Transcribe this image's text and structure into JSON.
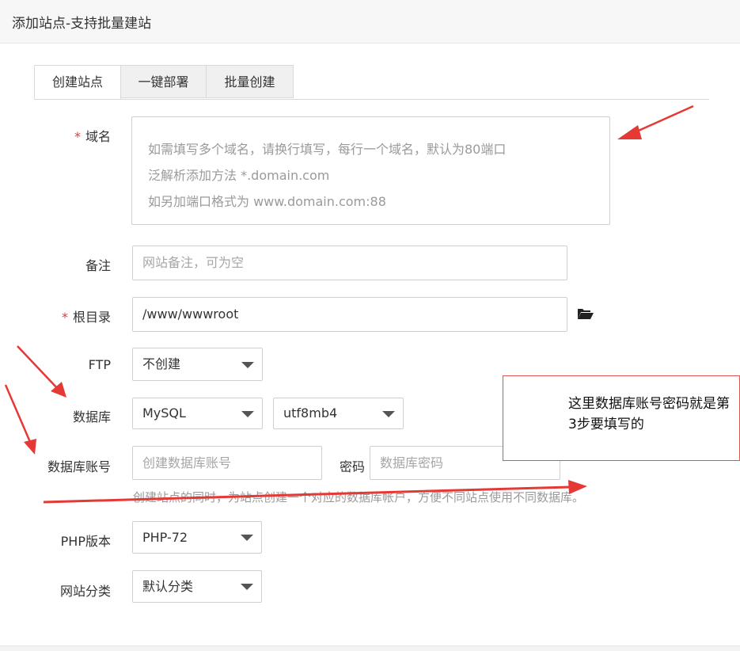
{
  "window": {
    "title": "添加站点-支持批量建站"
  },
  "tabs": [
    {
      "label": "创建站点",
      "active": true
    },
    {
      "label": "一键部署",
      "active": false
    },
    {
      "label": "批量创建",
      "active": false
    }
  ],
  "form": {
    "domain": {
      "required_mark": "*",
      "label": "域名",
      "placeholder_lines": [
        "如需填写多个域名，请换行填写，每行一个域名，默认为80端口",
        "泛解析添加方法 *.domain.com",
        "如另加端口格式为 www.domain.com:88"
      ]
    },
    "remark": {
      "label": "备注",
      "placeholder": "网站备注，可为空"
    },
    "root": {
      "required_mark": "*",
      "label": "根目录",
      "value": "/www/wwwroot",
      "icon": "folder-open-icon"
    },
    "ftp": {
      "label": "FTP",
      "selected": "不创建"
    },
    "database": {
      "label": "数据库",
      "type_selected": "MySQL",
      "charset_selected": "utf8mb4"
    },
    "db_account": {
      "label": "数据库账号",
      "account_placeholder": "创建数据库账号",
      "password_label": "密码",
      "password_placeholder": "数据库密码",
      "hint": "创建站点的同时，为站点创建一个对应的数据库帐户，方便不同站点使用不同数据库。"
    },
    "php": {
      "label": "PHP版本",
      "selected": "PHP-72"
    },
    "category": {
      "label": "网站分类",
      "selected": "默认分类"
    }
  },
  "annotation": {
    "note": "这里数据库账号密码就是第3步要填写的",
    "color": "#e53935"
  }
}
